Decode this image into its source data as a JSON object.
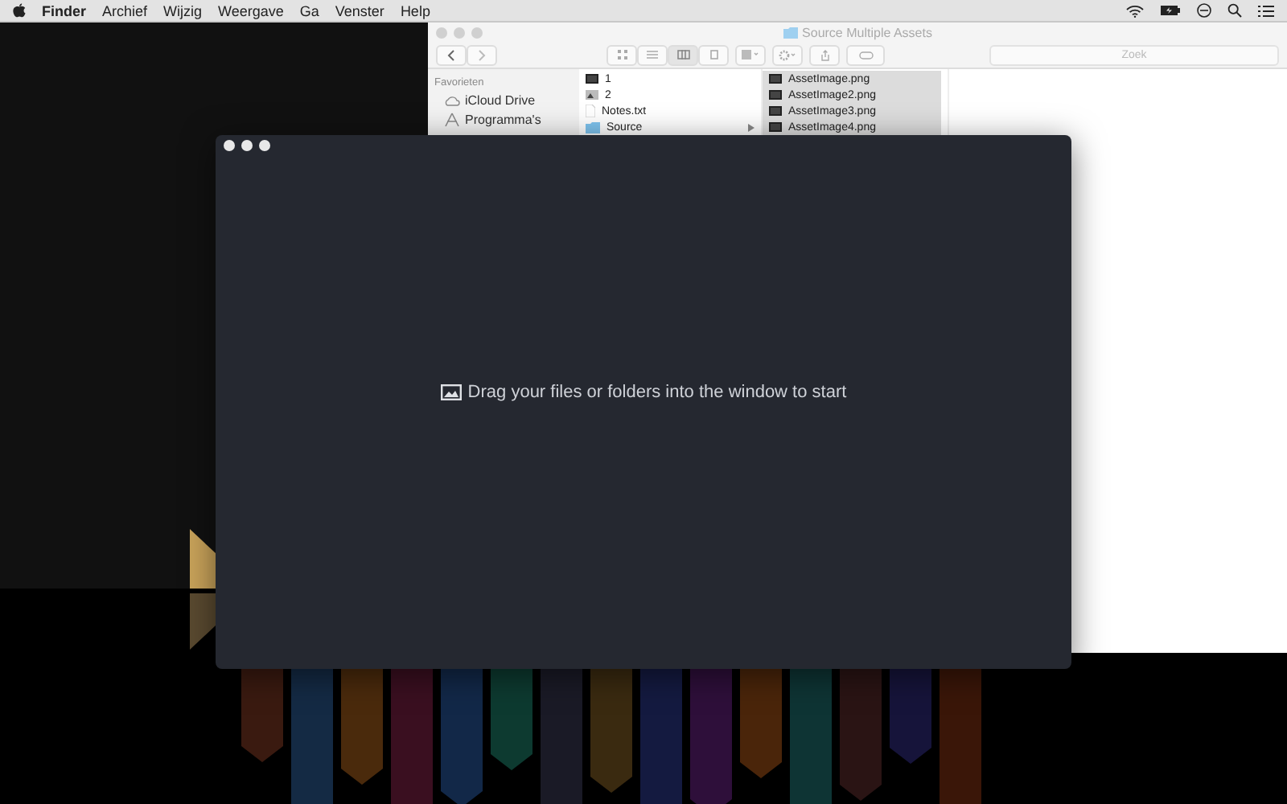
{
  "menu_bar": {
    "items": [
      {
        "label": "Finder",
        "kind": "app"
      },
      {
        "label": "Archief",
        "kind": "menu"
      },
      {
        "label": "Wijzig",
        "kind": "menu"
      },
      {
        "label": "Weergave",
        "kind": "menu"
      },
      {
        "label": "Ga",
        "kind": "menu"
      },
      {
        "label": "Venster",
        "kind": "menu"
      },
      {
        "label": "Help",
        "kind": "menu"
      }
    ]
  },
  "finder_window": {
    "title": "Source Multiple Assets",
    "search": {
      "placeholder": "Zoek"
    },
    "sidebar": {
      "heading": "Favorieten",
      "items": [
        {
          "label": "iCloud Drive",
          "kind": "cloud"
        },
        {
          "label": "Programma's",
          "kind": "apps"
        }
      ]
    },
    "columns": [
      [
        {
          "name": "1",
          "kind": "image",
          "selected": false
        },
        {
          "name": "2",
          "kind": "photo",
          "selected": false
        },
        {
          "name": "Notes.txt",
          "kind": "text",
          "selected": false
        },
        {
          "name": "Source",
          "kind": "folder",
          "selected": false
        }
      ],
      [
        {
          "name": "AssetImage.png",
          "kind": "image",
          "selected": true
        },
        {
          "name": "AssetImage2.png",
          "kind": "image",
          "selected": true
        },
        {
          "name": "AssetImage3.png",
          "kind": "image",
          "selected": true
        },
        {
          "name": "AssetImage4.png",
          "kind": "image",
          "selected": true
        }
      ]
    ]
  },
  "app_window": {
    "message": "Drag your files or folders into the window to start"
  }
}
